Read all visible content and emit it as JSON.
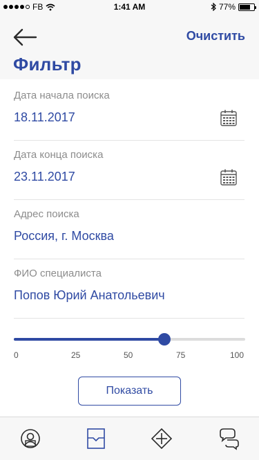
{
  "status_bar": {
    "carrier": "FB",
    "time": "1:41 AM",
    "battery": "77%",
    "battery_level": 0.77,
    "signal_dots_filled": 4,
    "signal_dots_total": 5,
    "icons": [
      "wifi-icon",
      "bluetooth-icon",
      "battery-icon"
    ]
  },
  "header": {
    "back_icon": "arrow-left-icon",
    "clear_label": "Очистить",
    "title": "Фильтр"
  },
  "fields": [
    {
      "label": "Дата начала поиска",
      "value": "18.11.2017",
      "icon": "calendar-icon"
    },
    {
      "label": "Дата конца поиска",
      "value": "23.11.2017",
      "icon": "calendar-icon"
    },
    {
      "label": "Адрес поиска",
      "value": "Россия, г. Москва"
    },
    {
      "label": "ФИО специалиста",
      "value": "Попов Юрий Анатольевич"
    }
  ],
  "slider": {
    "value": 65,
    "min": 0,
    "max": 100,
    "ticks": [
      "0",
      "25",
      "50",
      "75",
      "100"
    ]
  },
  "show_button": {
    "label": "Показать"
  },
  "bottom_nav": [
    {
      "icon": "profile-icon",
      "active": false
    },
    {
      "icon": "ticket-icon",
      "active": true
    },
    {
      "icon": "add-diamond-icon",
      "active": false
    },
    {
      "icon": "chat-bubbles-icon",
      "active": false
    }
  ],
  "colors": {
    "accent": "#2f4aa3",
    "label_gray": "#8c8c8c",
    "nav_background": "#f7f7f7"
  }
}
